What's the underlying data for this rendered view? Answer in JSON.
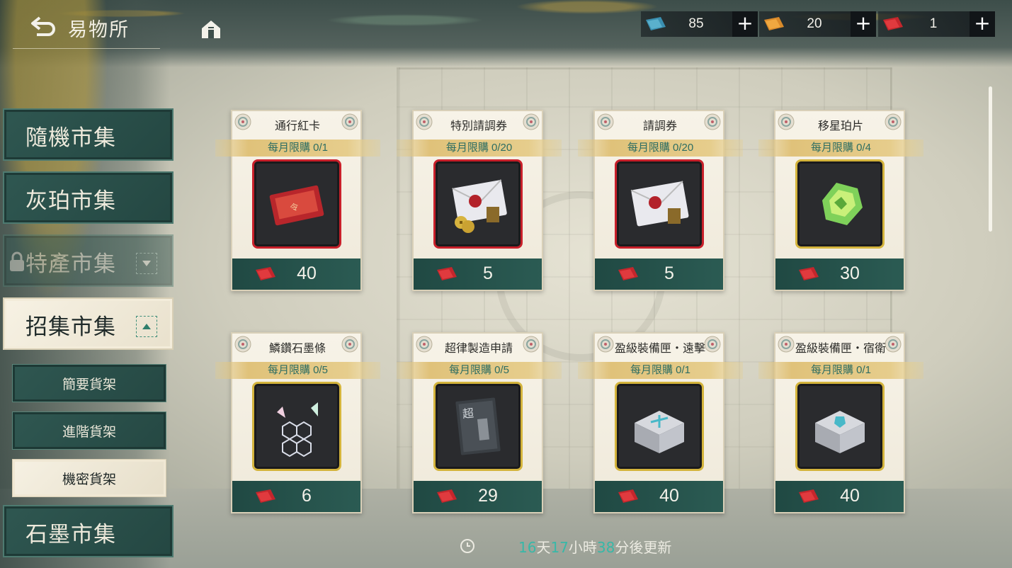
{
  "header": {
    "title": "易物所",
    "currencies": [
      {
        "icon": "blue-ticket-icon",
        "value": "85",
        "color": "#3a8fb0"
      },
      {
        "icon": "orange-ticket-icon",
        "value": "20",
        "color": "#d98a2a"
      },
      {
        "icon": "red-ticket-icon",
        "value": "1",
        "color": "#c4262c"
      }
    ],
    "plus_label": "+"
  },
  "sidebar": {
    "items": [
      {
        "label": "隨機市集",
        "state": "normal"
      },
      {
        "label": "灰珀市集",
        "state": "normal"
      },
      {
        "label": "特產市集",
        "state": "locked"
      },
      {
        "label": "招集市集",
        "state": "active"
      },
      {
        "label": "石墨市集",
        "state": "normal"
      }
    ],
    "sub_items": [
      {
        "label": "簡要貨架",
        "state": "normal"
      },
      {
        "label": "進階貨架",
        "state": "normal"
      },
      {
        "label": "機密貨架",
        "state": "active"
      }
    ]
  },
  "shop": {
    "items": [
      {
        "name": "通行紅卡",
        "limit": "每月限購 0/1",
        "price": "40",
        "frame": "red",
        "art": "red-card"
      },
      {
        "name": "特別請調券",
        "limit": "每月限購 0/20",
        "price": "5",
        "frame": "red",
        "art": "special-envelope"
      },
      {
        "name": "請調券",
        "limit": "每月限購 0/20",
        "price": "5",
        "frame": "red",
        "art": "envelope"
      },
      {
        "name": "移星珀片",
        "limit": "每月限購 0/4",
        "price": "30",
        "frame": "gold",
        "art": "amber-shard"
      },
      {
        "name": "鱗鑽石墨條",
        "limit": "每月限購 0/5",
        "price": "6",
        "frame": "gold",
        "art": "graphite"
      },
      {
        "name": "超律製造申請",
        "limit": "每月限購 0/5",
        "price": "29",
        "frame": "gold",
        "art": "booklet"
      },
      {
        "name": "盈級裝備匣・遠擊",
        "limit": "每月限購 0/1",
        "price": "40",
        "frame": "gold",
        "art": "equip-box-ranged"
      },
      {
        "name": "盈級裝備匣・宿衛",
        "limit": "每月限購 0/1",
        "price": "40",
        "frame": "gold",
        "art": "equip-box-guard"
      }
    ]
  },
  "footer": {
    "days": "16",
    "days_unit": "天",
    "hours": "17",
    "hours_unit": "小時",
    "minutes": "38",
    "minutes_unit": "分後更新"
  }
}
